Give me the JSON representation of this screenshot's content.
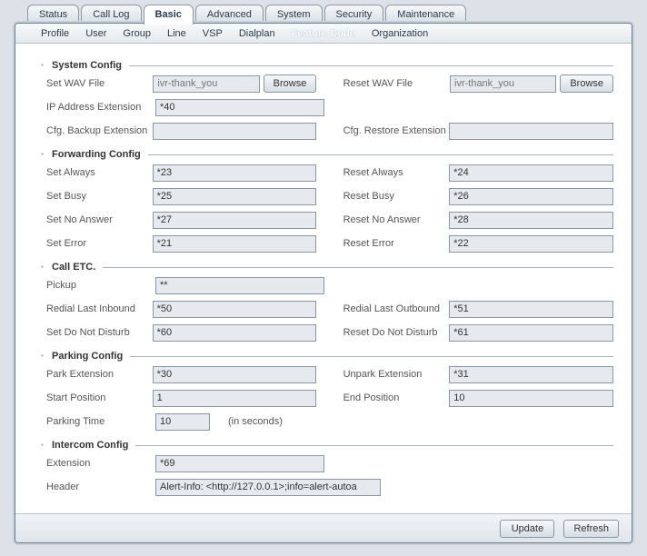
{
  "top_tabs": [
    "Status",
    "Call Log",
    "Basic",
    "Advanced",
    "System",
    "Security",
    "Maintenance"
  ],
  "top_tab_active_index": 2,
  "sub_tabs": [
    "Profile",
    "User",
    "Group",
    "Line",
    "VSP",
    "Dialplan",
    "Feature Code",
    "Organization"
  ],
  "sub_tab_active_index": 6,
  "sections": {
    "system": {
      "title": "System Config",
      "set_wav_label": "Set WAV File",
      "set_wav_placeholder": "ivr-thank_you",
      "browse_label": "Browse",
      "reset_wav_label": "Reset WAV File",
      "reset_wav_placeholder": "ivr-thank_you",
      "ip_ext_label": "IP Address Extension",
      "ip_ext_value": "*40",
      "cfg_backup_label": "Cfg. Backup Extension",
      "cfg_backup_value": "",
      "cfg_restore_label": "Cfg. Restore Extension",
      "cfg_restore_value": ""
    },
    "forwarding": {
      "title": "Forwarding Config",
      "set_always_label": "Set Always",
      "set_always_value": "*23",
      "reset_always_label": "Reset Always",
      "reset_always_value": "*24",
      "set_busy_label": "Set Busy",
      "set_busy_value": "*25",
      "reset_busy_label": "Reset Busy",
      "reset_busy_value": "*26",
      "set_noanswer_label": "Set No Answer",
      "set_noanswer_value": "*27",
      "reset_noanswer_label": "Reset No Answer",
      "reset_noanswer_value": "*28",
      "set_error_label": "Set Error",
      "set_error_value": "*21",
      "reset_error_label": "Reset Error",
      "reset_error_value": "*22"
    },
    "calletc": {
      "title": "Call ETC.",
      "pickup_label": "Pickup",
      "pickup_value": "**",
      "redial_in_label": "Redial Last Inbound",
      "redial_in_value": "*50",
      "redial_out_label": "Redial Last Outbound",
      "redial_out_value": "*51",
      "set_dnd_label": "Set Do Not Disturb",
      "set_dnd_value": "*60",
      "reset_dnd_label": "Reset Do Not Disturb",
      "reset_dnd_value": "*61"
    },
    "parking": {
      "title": "Parking Config",
      "park_ext_label": "Park Extension",
      "park_ext_value": "*30",
      "unpark_ext_label": "Unpark Extension",
      "unpark_ext_value": "*31",
      "start_pos_label": "Start Position",
      "start_pos_value": "1",
      "end_pos_label": "End Position",
      "end_pos_value": "10",
      "park_time_label": "Parking Time",
      "park_time_value": "10",
      "park_time_note": "(in seconds)"
    },
    "intercom": {
      "title": "Intercom Config",
      "ext_label": "Extension",
      "ext_value": "*69",
      "header_label": "Header",
      "header_value": "Alert-Info: <http://127.0.0.1>;info=alert-autoa"
    }
  },
  "footer": {
    "update": "Update",
    "refresh": "Refresh"
  }
}
